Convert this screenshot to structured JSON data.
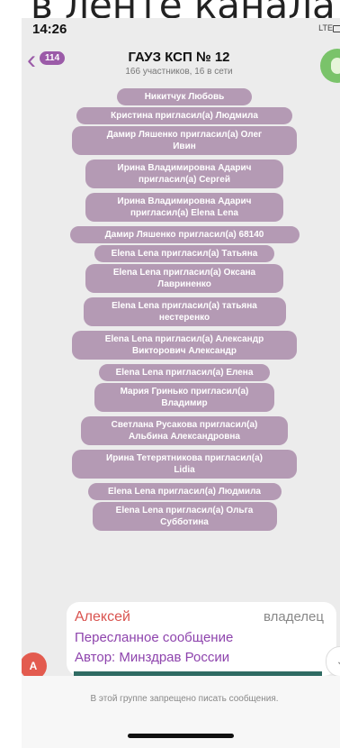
{
  "caption": "в ленте канала",
  "status_bar": {
    "time": "14:26",
    "network": "LTE"
  },
  "header": {
    "unread_badge": "114",
    "title": "ГАУЗ КСП № 12",
    "subtitle": "166 участников, 16 в сети"
  },
  "service_messages": [
    {
      "lines": [
        "Никитчук Любовь"
      ]
    },
    {
      "lines": [
        "Кристина пригласил(а) Людмила"
      ]
    },
    {
      "lines": [
        "Дамир Ляшенко пригласил(а) Олег",
        "Ивин"
      ]
    },
    {
      "lines": [
        "Ирина Владимировна Адарич",
        "пригласил(а) Сергей"
      ]
    },
    {
      "lines": [
        "Ирина Владимировна Адарич",
        "пригласил(а) Elena Lena"
      ]
    },
    {
      "lines": [
        "Дамир Ляшенко пригласил(а) 68140"
      ]
    },
    {
      "lines": [
        "Elena Lena пригласил(а) Татьяна"
      ]
    },
    {
      "lines": [
        "Elena Lena пригласил(а) Оксана",
        "Лавриненко"
      ]
    },
    {
      "lines": [
        "Elena Lena пригласил(а) татьяна",
        "нестеренко"
      ]
    },
    {
      "lines": [
        "Elena Lena пригласил(а) Александр",
        "Викторович Александр"
      ]
    },
    {
      "lines": [
        "Elena Lena пригласил(а) Елена"
      ]
    },
    {
      "lines": [
        "Мария Гринько пригласил(а)",
        "Владимир"
      ]
    },
    {
      "lines": [
        "Светлана Русакова пригласил(а)",
        "Альбина Александровна"
      ]
    },
    {
      "lines": [
        "Ирина Тетерятникова пригласил(а)",
        "Lidia"
      ]
    },
    {
      "lines": [
        "Elena Lena пригласил(а) Людмила"
      ]
    },
    {
      "lines": [
        "Elena Lena пригласил(а) Ольга",
        "Субботина"
      ]
    }
  ],
  "message_card": {
    "author": "Алексей",
    "role": "владелец",
    "forwarded": "Пересланное сообщение",
    "source": "Автор: Минздрав России"
  },
  "sender_avatar_initial": "A",
  "footer": {
    "notice": "В этой группе запрещено писать сообщения."
  },
  "icons": [
    "chevron-left-icon",
    "group-avatar-icon",
    "chevron-down-icon",
    "signal-icon",
    "battery-icon"
  ]
}
